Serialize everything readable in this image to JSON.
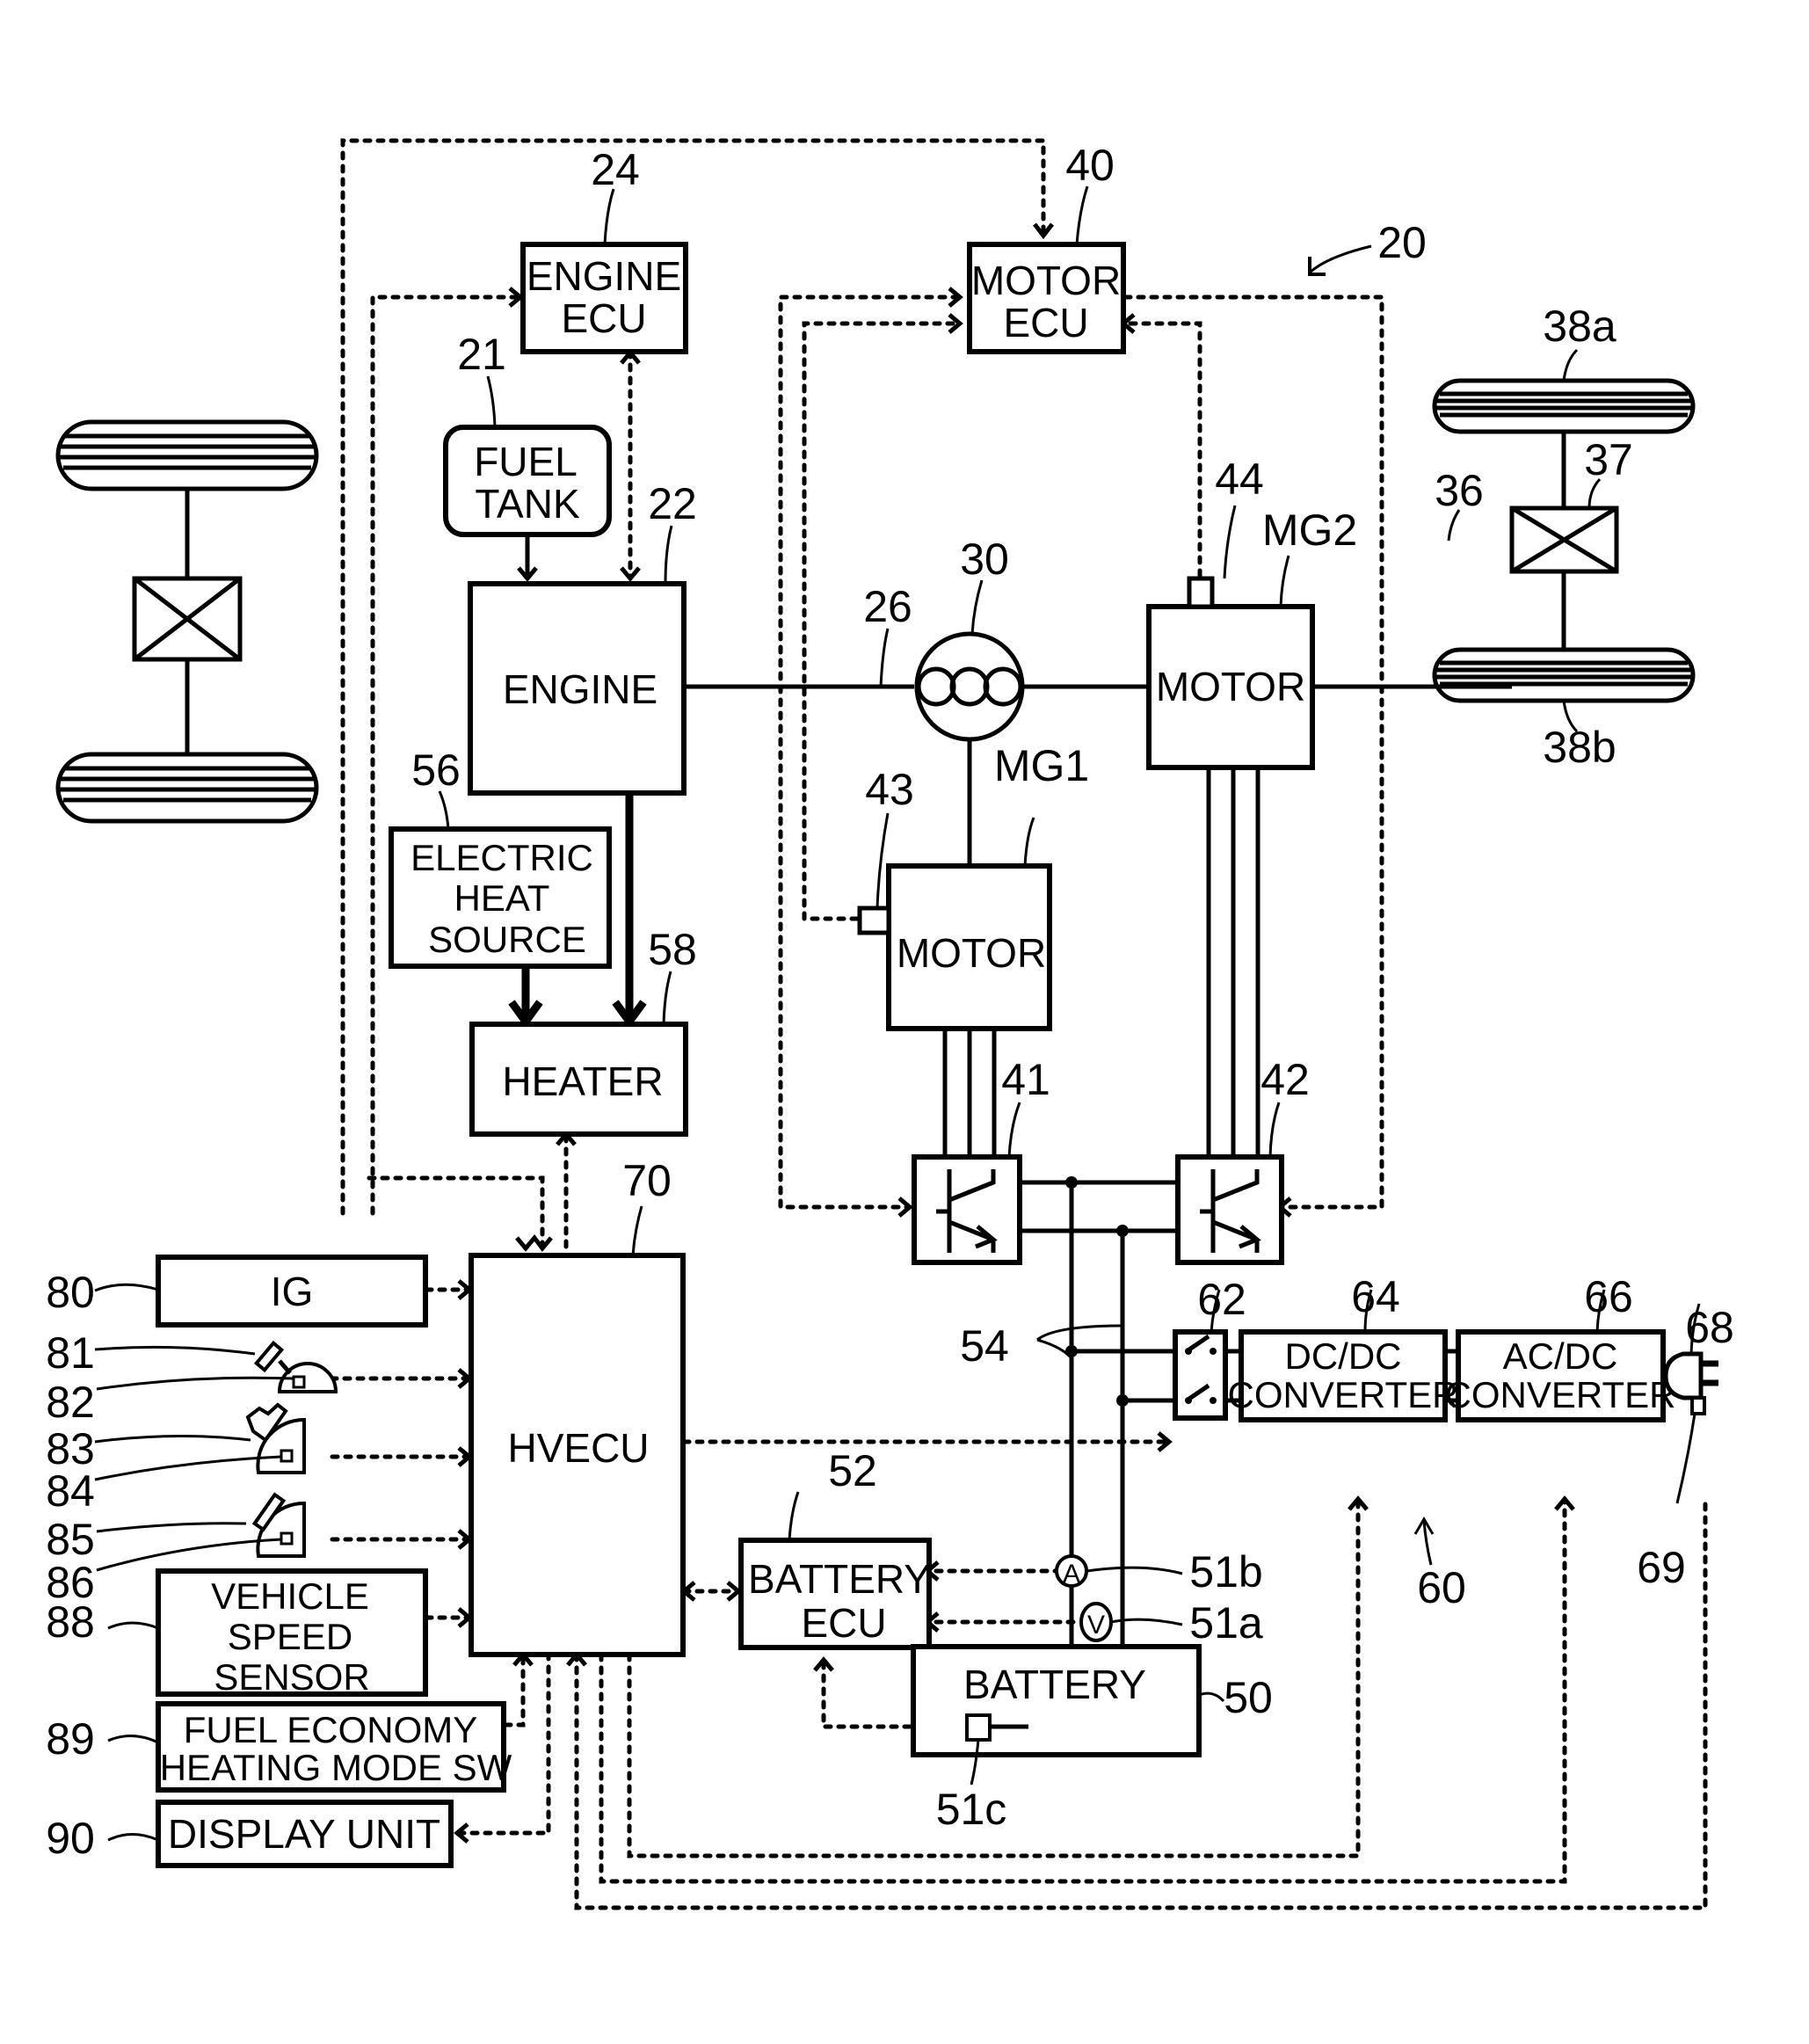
{
  "figure": {
    "system_ref": "20"
  },
  "blocks": {
    "engine_ecu": {
      "ref": "24",
      "lines": [
        "ENGINE",
        "ECU"
      ]
    },
    "motor_ecu": {
      "ref": "40",
      "lines": [
        "MOTOR",
        "ECU"
      ]
    },
    "fuel_tank": {
      "ref": "21",
      "lines": [
        "FUEL",
        "TANK"
      ]
    },
    "engine": {
      "ref": "22",
      "lines": [
        "ENGINE"
      ]
    },
    "electric_heat_source": {
      "ref": "56",
      "lines": [
        "ELECTRIC",
        "HEAT",
        "SOURCE"
      ]
    },
    "heater": {
      "ref": "58",
      "lines": [
        "HEATER"
      ]
    },
    "motor_mg1": {
      "ref": "MG1",
      "lines": [
        "MOTOR"
      ]
    },
    "motor_mg2": {
      "ref": "MG2",
      "lines": [
        "MOTOR"
      ]
    },
    "hvecu": {
      "ref": "70",
      "lines": [
        "HVECU"
      ]
    },
    "ig": {
      "ref": "80",
      "lines": [
        "IG"
      ]
    },
    "vehicle_speed_sensor": {
      "ref": "88",
      "lines": [
        "VEHICLE",
        "SPEED",
        "SENSOR"
      ]
    },
    "fuel_economy_sw": {
      "ref": "89",
      "lines": [
        "FUEL ECONOMY",
        "HEATING MODE SW"
      ]
    },
    "display_unit": {
      "ref": "90",
      "lines": [
        "DISPLAY UNIT"
      ]
    },
    "battery_ecu": {
      "ref": "52",
      "lines": [
        "BATTERY",
        "ECU"
      ]
    },
    "battery": {
      "ref": "50",
      "lines": [
        "BATTERY"
      ]
    },
    "dcdc_converter": {
      "ref": "64",
      "lines": [
        "DC/DC",
        "CONVERTER"
      ]
    },
    "acdc_converter": {
      "ref": "66",
      "lines": [
        "AC/DC",
        "CONVERTER"
      ]
    }
  },
  "refs": {
    "crankshaft": "26",
    "planetary_gear": "30",
    "drive_shaft": "36",
    "differential": "37",
    "wheel_front": "38a",
    "wheel_rear": "38b",
    "inverter1": "41",
    "inverter2": "42",
    "rotation_sensor1": "43",
    "rotation_sensor2": "44",
    "power_lines": "54",
    "relay": "62",
    "charger": "60",
    "plug": "68",
    "plug_sensor": "69",
    "ammeter": "51b",
    "voltmeter": "51a",
    "temp_sensor": "51c",
    "ignition_ref": "80",
    "shift_lever": "81",
    "shift_position_sensor": "82",
    "accel_pedal": "83",
    "accel_position_sensor": "84",
    "brake_pedal": "85",
    "brake_position_sensor": "86",
    "ammeter_symbol": "A",
    "voltmeter_symbol": "V"
  }
}
